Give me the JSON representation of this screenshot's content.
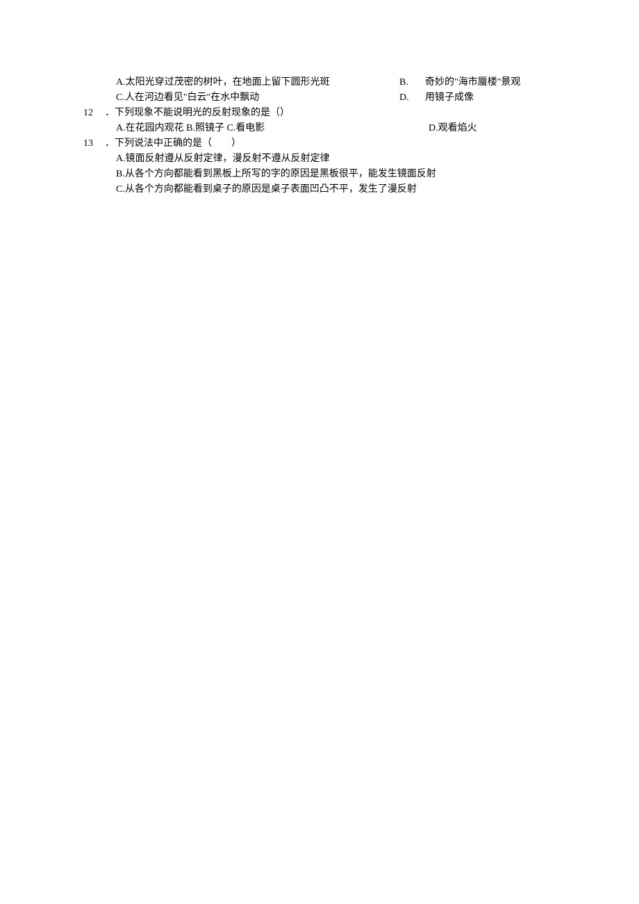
{
  "q11": {
    "optA": "A.太阳光穿过茂密的树叶，在地面上留下圆形光斑",
    "optB_label": "B.",
    "optB_text": "奇妙的\"海市蜃楼\"景观",
    "optC": "C.人在河边看见\"白云\"在水中飘动",
    "optD_label": "D.",
    "optD_text": "用镜子成像"
  },
  "q12": {
    "number": "12",
    "stem": "．下列现象不能说明光的反射现象的是（）",
    "optABC": "A.在花园内观花 B.照镜子 C.看电影",
    "optD": "D.观看焰火"
  },
  "q13": {
    "number": "13",
    "stem": "．下列说法中正确的是（　　）",
    "optA": "A.镜面反射遵从反射定律，漫反射不遵从反射定律",
    "optB": "B.从各个方向都能看到黑板上所写的字的原因是黑板很平，能发生镜面反射",
    "optC": "C.从各个方向都能看到桌子的原因是桌子表面凹凸不平，发生了漫反射"
  }
}
